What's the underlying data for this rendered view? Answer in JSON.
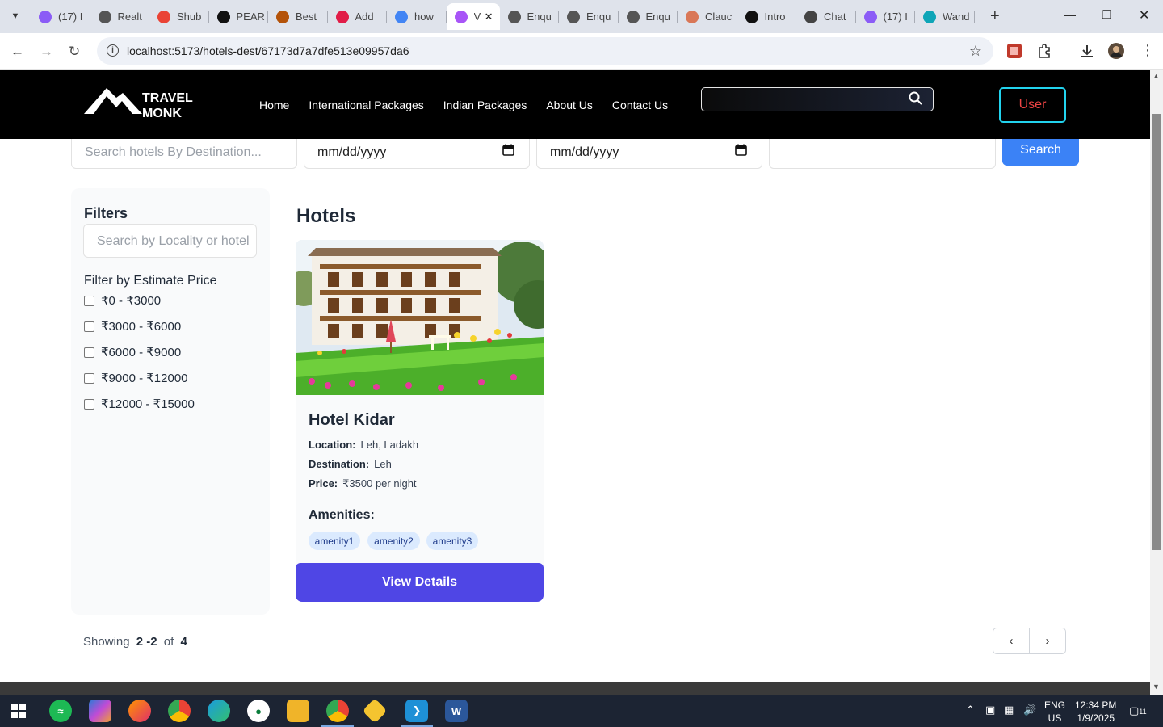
{
  "browser": {
    "tabs": [
      {
        "label": "(17) I",
        "icon": "messenger-icon",
        "color": "#8b5cf6"
      },
      {
        "label": "Realt",
        "icon": "globe-icon",
        "color": "#555"
      },
      {
        "label": "Shub",
        "icon": "gmail-icon",
        "color": "#ea4335"
      },
      {
        "label": "PEAR",
        "icon": "pw-icon",
        "color": "#111"
      },
      {
        "label": "Best",
        "icon": "figure-icon",
        "color": "#b45309"
      },
      {
        "label": "Add",
        "icon": "chart-icon",
        "color": "#e11d48"
      },
      {
        "label": "how",
        "icon": "google-icon",
        "color": "#4285f4"
      },
      {
        "label": "V",
        "icon": "vite-icon",
        "color": "#a855f7",
        "active": true
      },
      {
        "label": "Enqu",
        "icon": "globe-icon",
        "color": "#555"
      },
      {
        "label": "Enqu",
        "icon": "globe-icon",
        "color": "#555"
      },
      {
        "label": "Enqu",
        "icon": "globe-icon",
        "color": "#555"
      },
      {
        "label": "Clauc",
        "icon": "claude-icon",
        "color": "#d97757"
      },
      {
        "label": "Intro",
        "icon": "openai-icon",
        "color": "#111"
      },
      {
        "label": "Chat",
        "icon": "openai-icon",
        "color": "#444"
      },
      {
        "label": "(17) I",
        "icon": "messenger-icon",
        "color": "#8b5cf6"
      },
      {
        "label": "Wand",
        "icon": "wand-icon",
        "color": "#0ea5b7"
      }
    ],
    "url": "localhost:5173/hotels-dest/67173d7a7dfe513e09957da6"
  },
  "navbar": {
    "logo_line1": "TRAVEL",
    "logo_line2": "MONK",
    "links": [
      "Home",
      "International Packages",
      "Indian Packages",
      "About Us",
      "Contact Us"
    ],
    "user_label": "User"
  },
  "search": {
    "destination_placeholder": "Search hotels By Destination...",
    "checkin_value": "mm/dd/yyyy",
    "checkout_value": "mm/dd/yyyy",
    "guests_value": "",
    "button_label": "Search"
  },
  "filters": {
    "title": "Filters",
    "locality_placeholder": "Search by Locality or hotel",
    "price_title": "Filter by Estimate Price",
    "price_ranges": [
      "₹0 - ₹3000",
      "₹3000 - ₹6000",
      "₹6000 - ₹9000",
      "₹9000 - ₹12000",
      "₹12000 - ₹15000"
    ]
  },
  "hotels": {
    "title": "Hotels",
    "items": [
      {
        "name": "Hotel Kidar",
        "location_label": "Location:",
        "location": "Leh, Ladakh",
        "destination_label": "Destination:",
        "destination": "Leh",
        "price_label": "Price:",
        "price": "₹3500 per night",
        "amenities_label": "Amenities:",
        "amenities": [
          "amenity1",
          "amenity2",
          "amenity3"
        ],
        "button_label": "View Details"
      }
    ]
  },
  "pagination": {
    "showing_label": "Showing",
    "range": "2 -2",
    "of_label": "of",
    "total": "4"
  },
  "taskbar": {
    "lang": "ENG",
    "region": "US",
    "time": "12:34 PM",
    "date": "1/9/2025",
    "notifications": "11"
  }
}
